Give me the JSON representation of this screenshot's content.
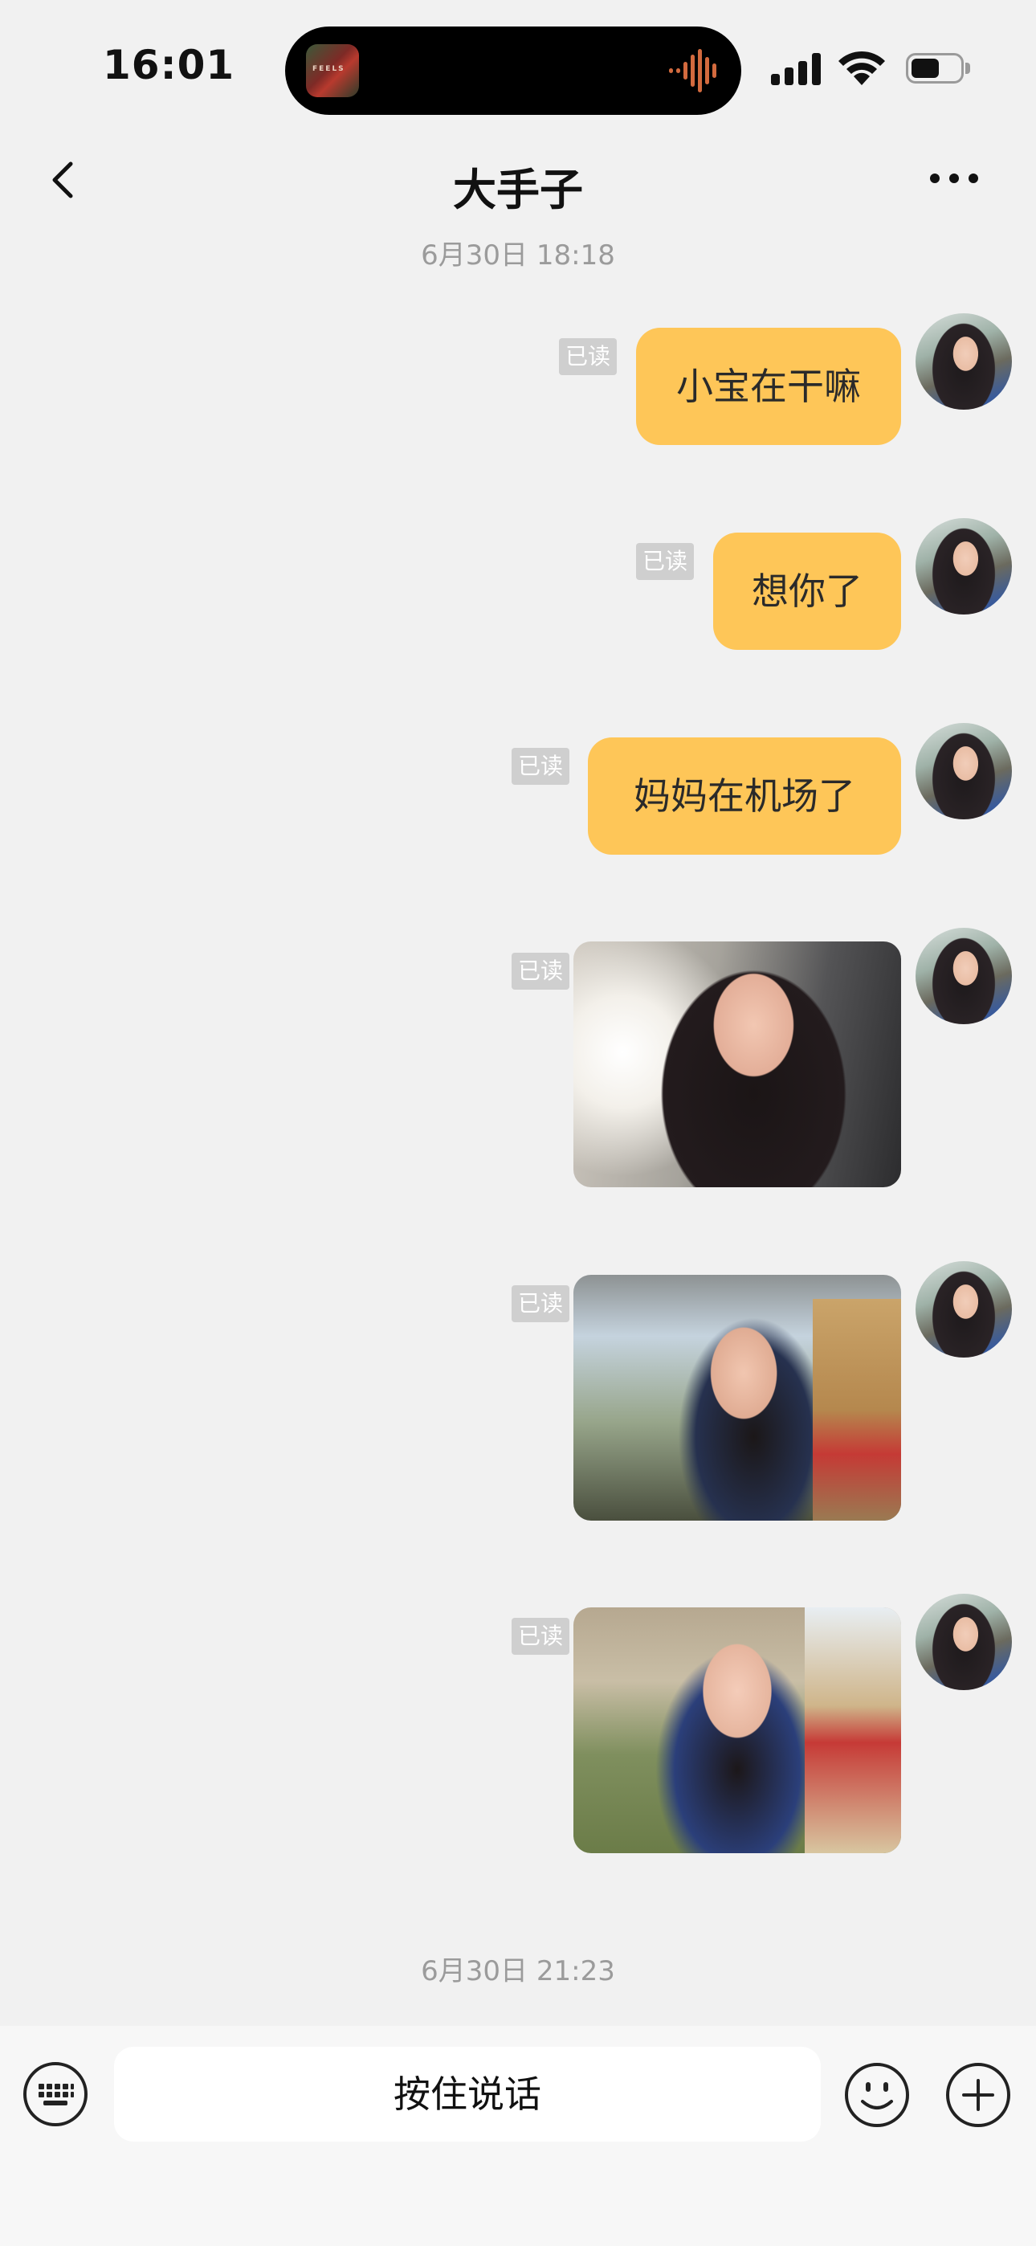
{
  "status_bar": {
    "time": "16:01",
    "album_art_text": "FEELS"
  },
  "nav": {
    "title": "大手子"
  },
  "timestamps": [
    "6月30日 18:18",
    "6月30日 21:23"
  ],
  "read_label": "已读",
  "messages": [
    {
      "type": "text",
      "text": "小宝在干嘛"
    },
    {
      "type": "text",
      "text": "想你了"
    },
    {
      "type": "text",
      "text": "妈妈在机场了"
    },
    {
      "type": "image",
      "description": "selfie in car"
    },
    {
      "type": "image",
      "description": "selfie outdoors"
    },
    {
      "type": "image",
      "description": "selfie near plants"
    }
  ],
  "input_bar": {
    "voice_label": "按住说话"
  },
  "colors": {
    "bubble": "#fec658",
    "background": "#f1f1f1",
    "read_tag": "#cfcfcf"
  },
  "icons": [
    "back-icon",
    "more-icon",
    "keyboard-icon",
    "emoji-icon",
    "plus-icon",
    "signal-icon",
    "wifi-icon",
    "battery-icon"
  ]
}
